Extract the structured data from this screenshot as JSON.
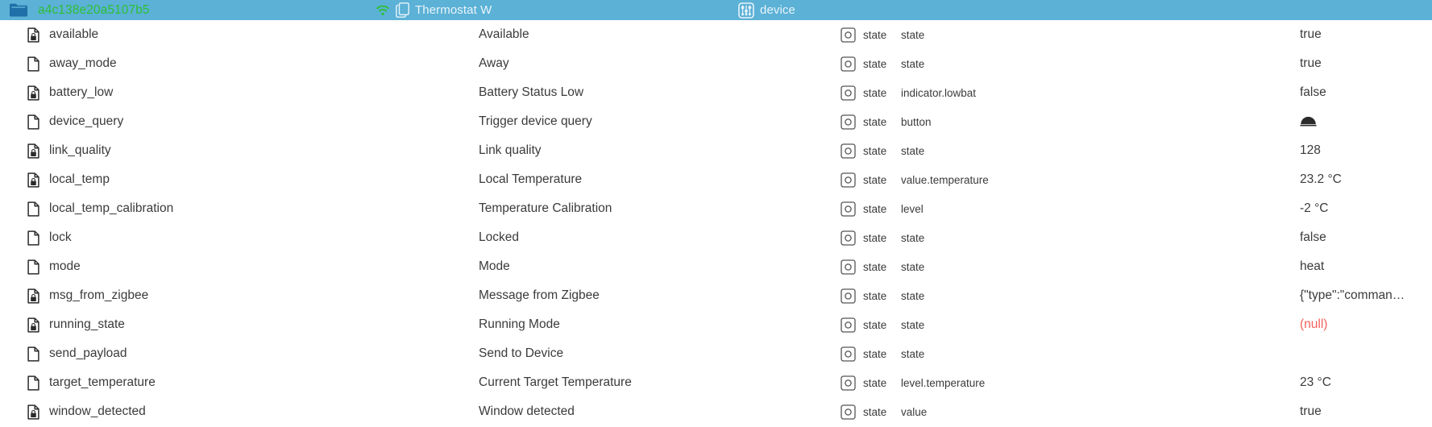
{
  "header": {
    "object_icon": "folder-icon",
    "object_label": "a4c138e20a5107b5",
    "name_icons": [
      "wifi-icon",
      "pages-icon"
    ],
    "name_label": "Thermostat W",
    "role_icon": "sliders-icon",
    "role_label": "device",
    "bar_color": "#5bb1d6",
    "object_label_color": "#2fbf34"
  },
  "colors": {
    "null_value": "#f4605a",
    "text": "#3b3b3b",
    "header_text": "#e9f4fa"
  },
  "rows": [
    {
      "icon": "document-locked-icon",
      "id": "available",
      "name": "Available",
      "type_icon": "state-icon",
      "type": "state",
      "role": "state",
      "value": "true",
      "value_kind": "text"
    },
    {
      "icon": "document-icon",
      "id": "away_mode",
      "name": "Away",
      "type_icon": "state-icon",
      "type": "state",
      "role": "state",
      "value": "true",
      "value_kind": "text"
    },
    {
      "icon": "document-locked-icon",
      "id": "battery_low",
      "name": "Battery Status Low",
      "type_icon": "state-icon",
      "type": "state",
      "role": "indicator.lowbat",
      "value": "false",
      "value_kind": "text"
    },
    {
      "icon": "document-icon",
      "id": "device_query",
      "name": "Trigger device query",
      "type_icon": "state-icon",
      "type": "state",
      "role": "button",
      "value": "",
      "value_kind": "button-icon"
    },
    {
      "icon": "document-locked-icon",
      "id": "link_quality",
      "name": "Link quality",
      "type_icon": "state-icon",
      "type": "state",
      "role": "state",
      "value": "128",
      "value_kind": "text"
    },
    {
      "icon": "document-locked-icon",
      "id": "local_temp",
      "name": "Local Temperature",
      "type_icon": "state-icon",
      "type": "state",
      "role": "value.temperature",
      "value": "23.2 °C",
      "value_kind": "text"
    },
    {
      "icon": "document-icon",
      "id": "local_temp_calibration",
      "name": "Temperature Calibration",
      "type_icon": "state-icon",
      "type": "state",
      "role": "level",
      "value": "-2 °C",
      "value_kind": "text"
    },
    {
      "icon": "document-icon",
      "id": "lock",
      "name": "Locked",
      "type_icon": "state-icon",
      "type": "state",
      "role": "state",
      "value": "false",
      "value_kind": "text"
    },
    {
      "icon": "document-icon",
      "id": "mode",
      "name": "Mode",
      "type_icon": "state-icon",
      "type": "state",
      "role": "state",
      "value": "heat",
      "value_kind": "text"
    },
    {
      "icon": "document-locked-icon",
      "id": "msg_from_zigbee",
      "name": "Message from Zigbee",
      "type_icon": "state-icon",
      "type": "state",
      "role": "state",
      "value": "{\"type\":\"comman…",
      "value_kind": "text"
    },
    {
      "icon": "document-locked-icon",
      "id": "running_state",
      "name": "Running Mode",
      "type_icon": "state-icon",
      "type": "state",
      "role": "state",
      "value": "(null)",
      "value_kind": "null"
    },
    {
      "icon": "document-icon",
      "id": "send_payload",
      "name": "Send to Device",
      "type_icon": "state-icon",
      "type": "state",
      "role": "state",
      "value": "",
      "value_kind": "text"
    },
    {
      "icon": "document-icon",
      "id": "target_temperature",
      "name": "Current Target Temperature",
      "type_icon": "state-icon",
      "type": "state",
      "role": "level.temperature",
      "value": "23 °C",
      "value_kind": "text"
    },
    {
      "icon": "document-locked-icon",
      "id": "window_detected",
      "name": "Window detected",
      "type_icon": "state-icon",
      "type": "state",
      "role": "value",
      "value": "true",
      "value_kind": "text"
    }
  ]
}
